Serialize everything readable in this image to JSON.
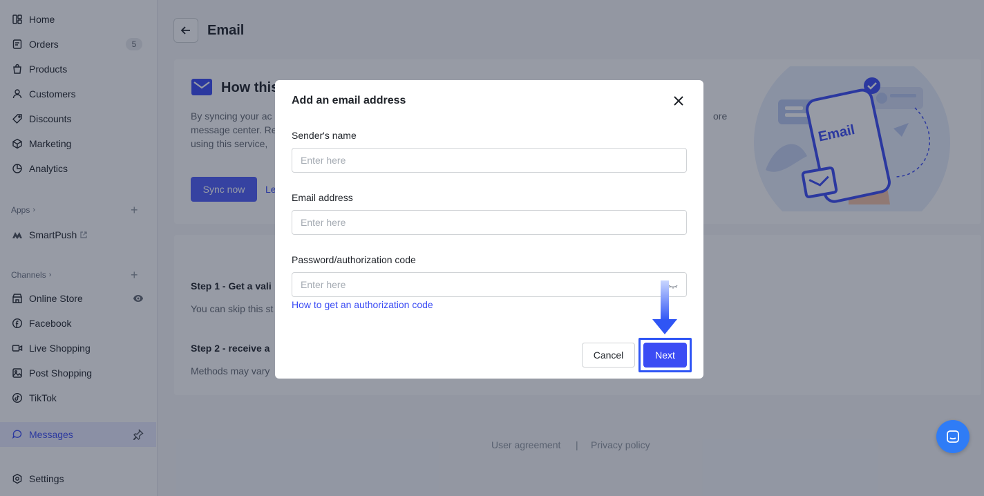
{
  "sidebar": {
    "items": [
      {
        "label": "Home",
        "icon": "home-icon"
      },
      {
        "label": "Orders",
        "icon": "orders-icon",
        "badge": "5"
      },
      {
        "label": "Products",
        "icon": "products-icon"
      },
      {
        "label": "Customers",
        "icon": "customers-icon"
      },
      {
        "label": "Discounts",
        "icon": "discounts-icon"
      },
      {
        "label": "Marketing",
        "icon": "marketing-icon"
      },
      {
        "label": "Analytics",
        "icon": "analytics-icon"
      }
    ],
    "apps_label": "Apps",
    "apps": [
      {
        "label": "SmartPush",
        "icon": "smartpush-icon"
      }
    ],
    "channels_label": "Channels",
    "channels": [
      {
        "label": "Online Store",
        "icon": "store-icon"
      },
      {
        "label": "Facebook",
        "icon": "facebook-icon"
      },
      {
        "label": "Live Shopping",
        "icon": "live-icon"
      },
      {
        "label": "Post Shopping",
        "icon": "post-icon"
      },
      {
        "label": "TikTok",
        "icon": "tiktok-icon"
      }
    ],
    "messages": {
      "label": "Messages",
      "icon": "messages-icon"
    },
    "settings": {
      "label": "Settings",
      "icon": "settings-icon"
    }
  },
  "header": {
    "title": "Email"
  },
  "intro": {
    "title": "How this",
    "desc_line1": "By syncing your ac",
    "desc_line1_tail": "ore",
    "desc_line2": "message center. Re",
    "desc_line3": "using this service, ",
    "sync_label": "Sync now",
    "learn_label": "Le"
  },
  "steps": {
    "step1_title": "Step 1 - Get a vali",
    "step1_desc": "You can skip this st",
    "step2_title": "Step 2 - receive a",
    "step2_desc": "Methods may vary"
  },
  "footer": {
    "agreement": "User agreement",
    "separator": "|",
    "privacy": "Privacy policy"
  },
  "illustration": {
    "label": "Email"
  },
  "modal": {
    "title": "Add an email address",
    "sender_label": "Sender's name",
    "sender_placeholder": "Enter here",
    "email_label": "Email address",
    "email_placeholder": "Enter here",
    "password_label": "Password/authorization code",
    "password_placeholder": "Enter here",
    "help_link": "How to get an authorization code",
    "cancel_label": "Cancel",
    "next_label": "Next"
  },
  "colors": {
    "primary": "#3b4cf4",
    "highlight": "#2f55f5",
    "chat": "#2f7cf6"
  }
}
